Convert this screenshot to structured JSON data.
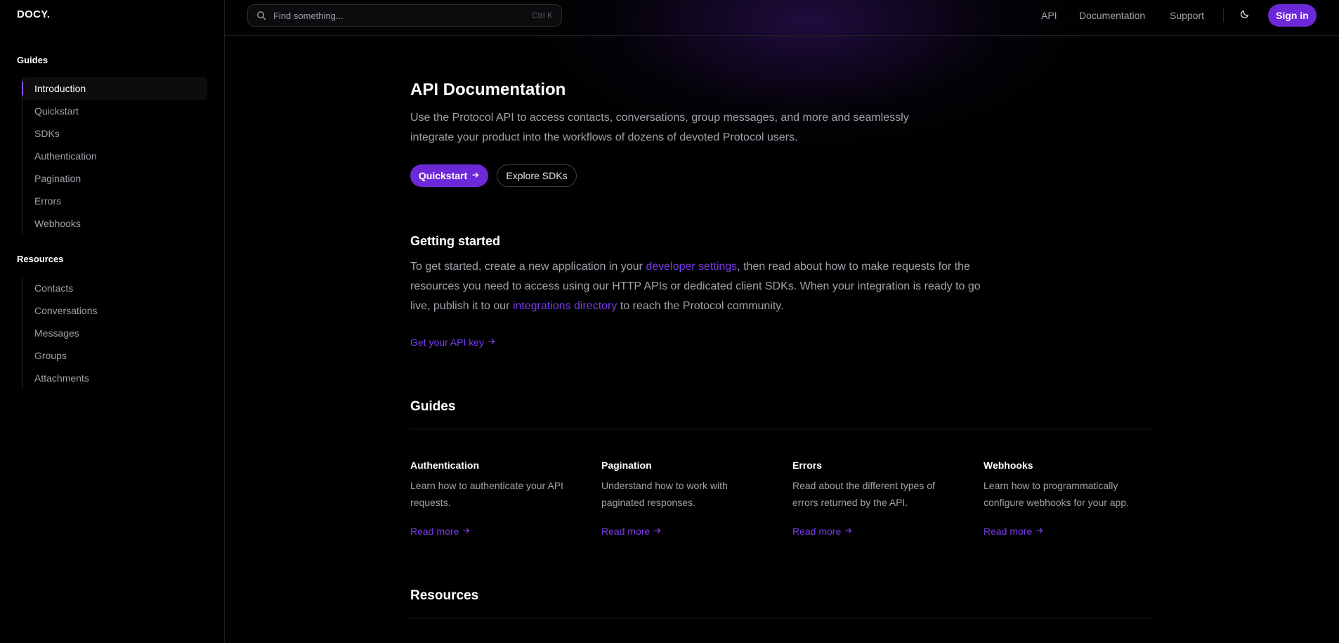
{
  "brand": {
    "logo": "DOCY."
  },
  "search": {
    "placeholder": "Find something...",
    "shortcut": "Ctrl K"
  },
  "topnav": {
    "api": "API",
    "documentation": "Documentation",
    "support": "Support",
    "sign_in": "Sign in"
  },
  "sidebar": {
    "guides_title": "Guides",
    "guides": [
      {
        "label": "Introduction",
        "active": true
      },
      {
        "label": "Quickstart"
      },
      {
        "label": "SDKs"
      },
      {
        "label": "Authentication"
      },
      {
        "label": "Pagination"
      },
      {
        "label": "Errors"
      },
      {
        "label": "Webhooks"
      }
    ],
    "resources_title": "Resources",
    "resources": [
      {
        "label": "Contacts"
      },
      {
        "label": "Conversations"
      },
      {
        "label": "Messages"
      },
      {
        "label": "Groups"
      },
      {
        "label": "Attachments"
      }
    ]
  },
  "hero": {
    "title": "API Documentation",
    "lead": "Use the Protocol API to access contacts, conversations, group messages, and more and seamlessly integrate your product into the workflows of dozens of devoted Protocol users.",
    "primary_button": "Quickstart",
    "secondary_button": "Explore SDKs"
  },
  "getting_started": {
    "title": "Getting started",
    "text_1": "To get started, create a new application in your ",
    "link_1": "developer settings",
    "text_2": ", then read about how to make requests for the resources you need to access using our HTTP APIs or dedicated client SDKs. When your integration is ready to go live, publish it to our ",
    "link_2": "integrations directory",
    "text_3": " to reach the Protocol community.",
    "cta": "Get your API key"
  },
  "guides_section": {
    "title": "Guides",
    "items": [
      {
        "title": "Authentication",
        "description": "Learn how to authenticate your API requests.",
        "link": "Read more"
      },
      {
        "title": "Pagination",
        "description": "Understand how to work with paginated responses.",
        "link": "Read more"
      },
      {
        "title": "Errors",
        "description": "Read about the different types of errors returned by the API.",
        "link": "Read more"
      },
      {
        "title": "Webhooks",
        "description": "Learn how to programmatically configure webhooks for your app.",
        "link": "Read more"
      }
    ]
  },
  "resources_section": {
    "title": "Resources"
  },
  "icons": {
    "search": "search-icon",
    "theme": "moon-icon",
    "arrow": "arrow-right-icon"
  },
  "colors": {
    "accent": "#6d28d9",
    "link": "#7c3aed",
    "background": "#000000"
  }
}
